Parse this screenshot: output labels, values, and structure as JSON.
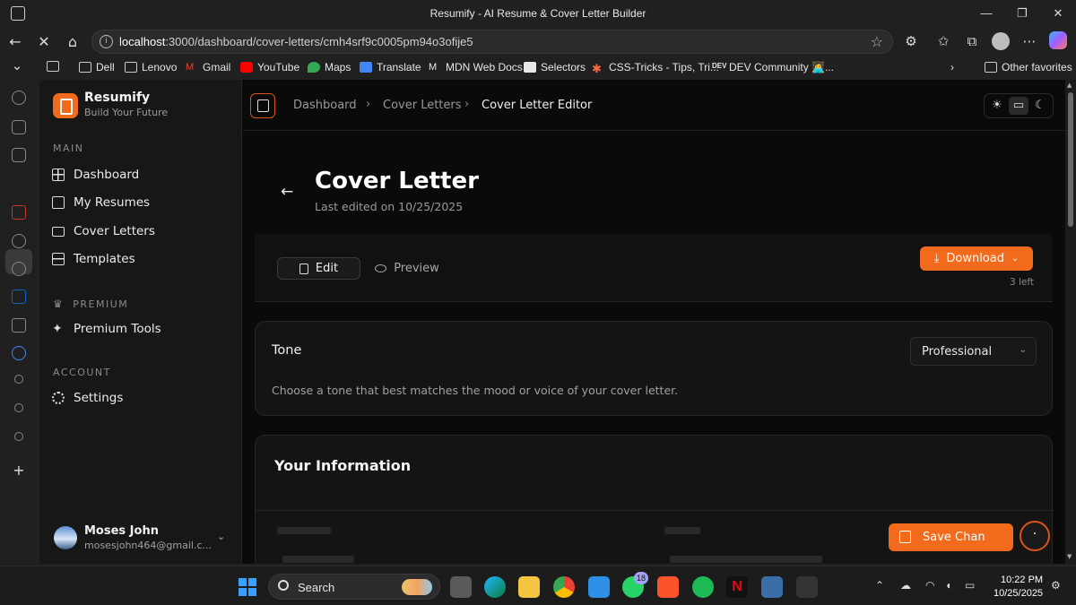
{
  "browser": {
    "window_title": "Resumify - AI Resume & Cover Letter Builder",
    "url_host": "localhost",
    "url_path": ":3000/dashboard/cover-letters/cmh4srf9c0005pm94o3ofije5",
    "bookmarks": [
      "Dell",
      "Lenovo",
      "Gmail",
      "YouTube",
      "Maps",
      "Translate",
      "MDN Web Docs",
      "Selectors",
      "CSS-Tricks - Tips, Tri...",
      "DEV Community 👩‍💻..."
    ],
    "other_favorites": "Other favorites"
  },
  "sidebar": {
    "brand_name": "Resumify",
    "brand_tagline": "Build Your Future",
    "sections": {
      "main": "MAIN",
      "premium": "PREMIUM",
      "account": "ACCOUNT"
    },
    "items": {
      "dashboard": "Dashboard",
      "resumes": "My Resumes",
      "cover_letters": "Cover Letters",
      "templates": "Templates",
      "premium_tools": "Premium Tools",
      "settings": "Settings"
    },
    "user": {
      "name": "Moses John",
      "email": "mosesjohn464@gmail.c..."
    }
  },
  "header": {
    "breadcrumb": [
      "Dashboard",
      "Cover Letters",
      "Cover Letter Editor"
    ]
  },
  "page": {
    "title": "Cover Letter",
    "last_edited": "Last edited on 10/25/2025",
    "tabs": {
      "edit": "Edit",
      "preview": "Preview"
    },
    "download_label": "Download",
    "downloads_left": "3 left",
    "tone": {
      "label": "Tone",
      "selected": "Professional",
      "description": "Choose a tone that best matches the mood or voice of your cover letter."
    },
    "info_title": "Your Information",
    "save_label": "Save Chan"
  },
  "taskbar": {
    "search_label": "Search",
    "whatsapp_badge": "18",
    "time": "10:22 PM",
    "date": "10/25/2025"
  },
  "colors": {
    "accent": "#f26a1b",
    "app_bg": "#0a0a0a",
    "sidebar_bg": "#171717",
    "card_bg": "#141414"
  }
}
